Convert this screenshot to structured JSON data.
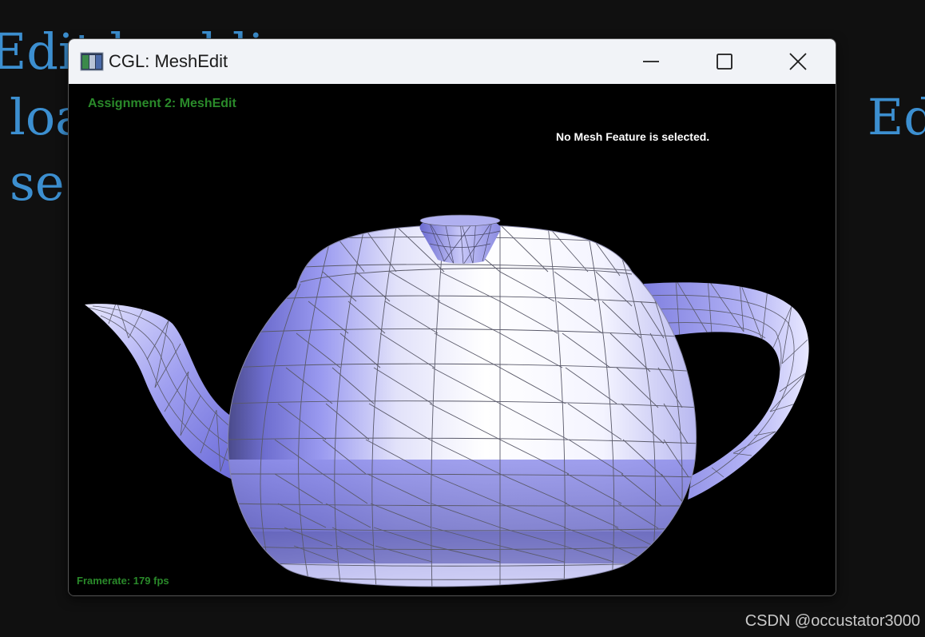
{
  "background": {
    "line1": "Edit  load  li",
    "line2": "loa",
    "line2_right": "Ed",
    "line3": "se"
  },
  "window": {
    "title": "CGL: MeshEdit",
    "icon": "app-window-icon",
    "controls": {
      "minimize": "minimize-icon",
      "maximize": "maximize-icon",
      "close": "close-icon"
    }
  },
  "viewport": {
    "assignment_title": "Assignment 2: MeshEdit",
    "selection_status": "No Mesh Feature is selected.",
    "framerate": "Framerate: 179 fps",
    "mesh_name": "teapot",
    "colors": {
      "background": "#000000",
      "hud_green": "#2a8a2a",
      "mesh_lit": "#ffffff",
      "mesh_shadow": "#7f7fe6",
      "wireframe": "#5a5a6a"
    }
  },
  "watermark": "CSDN @occustator3000"
}
